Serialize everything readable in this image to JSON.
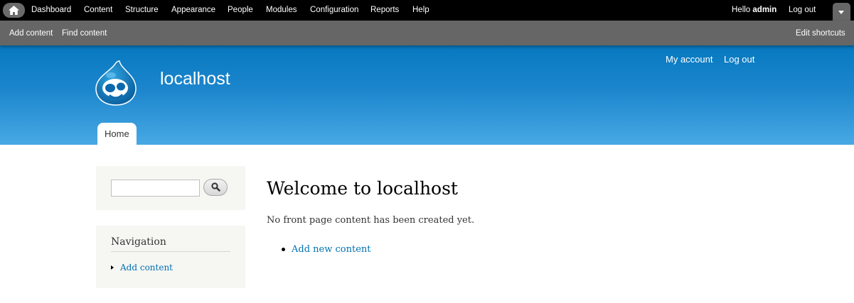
{
  "toolbar": {
    "home_icon": "home-icon",
    "menu": [
      "Dashboard",
      "Content",
      "Structure",
      "Appearance",
      "People",
      "Modules",
      "Configuration",
      "Reports",
      "Help"
    ],
    "hello_prefix": "Hello ",
    "username": "admin",
    "logout": "Log out",
    "drawer_icon": "chevron-down-icon"
  },
  "shortcuts": {
    "items": [
      "Add content",
      "Find content"
    ],
    "edit": "Edit shortcuts"
  },
  "header": {
    "logo": "drupal-drop-logo",
    "site_name": "localhost",
    "secondary_menu": [
      "My account",
      "Log out"
    ],
    "tabs": [
      "Home"
    ]
  },
  "sidebar": {
    "search": {
      "value": "",
      "button_icon": "search-icon"
    },
    "navigation": {
      "title": "Navigation",
      "items": [
        "Add content"
      ]
    }
  },
  "main": {
    "title": "Welcome to localhost",
    "message": "No front page content has been created yet.",
    "links": [
      "Add new content"
    ]
  },
  "colors": {
    "toolbar_bg": "#000000",
    "shortcut_bar_bg": "#666666",
    "header_top": "#0779bf",
    "header_bottom": "#48a9e4",
    "link": "#0071b3",
    "sidebar_bg": "#f6f6f2"
  }
}
